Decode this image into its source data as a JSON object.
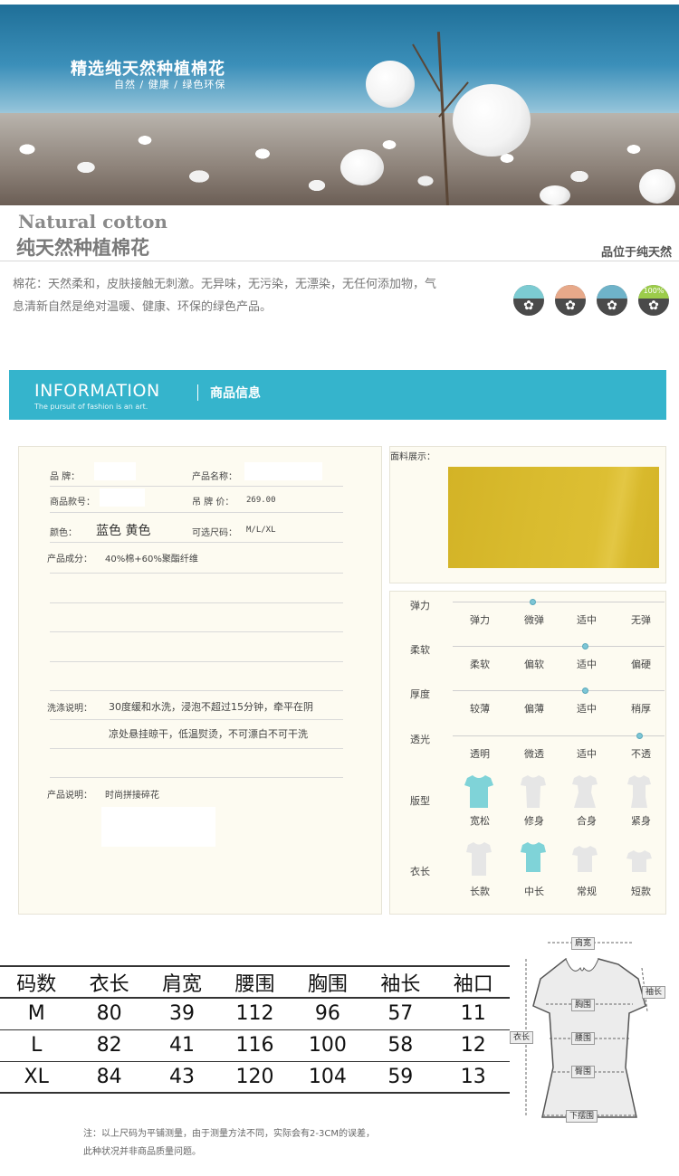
{
  "hero": {
    "title": "精选纯天然种植棉花",
    "subtitle": "自然 / 健康 / 绿色环保"
  },
  "natural": {
    "title_en": "Natural cotton",
    "title_cn": "纯天然种植棉花",
    "right_text": "品位于纯天然",
    "description": "棉花：天然柔和，皮肤接触无刺激。无异味，无污染，无漂染，无任何添加物，气息清新自然是绝对温暖、健康、环保的绿色产品。",
    "badge_text": "100%",
    "icon_colors": [
      "#7ccbd2",
      "#e7a98a",
      "#6fb3c9",
      "#9ccc4a"
    ]
  },
  "info_bar": {
    "title_en": "INFORMATION",
    "subtitle_en": "The pursuit of fashion is an art.",
    "title_cn": "商品信息"
  },
  "product": {
    "brand_label": "品 牌：",
    "name_label": "产品名称：",
    "sku_label": "商品款号：",
    "price_label": "吊 牌 价：",
    "price_value": "269.00",
    "color_label": "颜色：",
    "color_value": "蓝色  黄色",
    "sizes_label": "可选尺码：",
    "sizes_value": "M/L/XL",
    "composition_label": "产品成分：",
    "composition_value": "40%棉+60%聚酯纤维",
    "wash_label": "洗涤说明：",
    "wash_line1": "30度缓和水洗，浸泡不超过15分钟，牵平在阴",
    "wash_line2": "凉处悬挂晾干，低温熨烫，不可漂白不可干洗",
    "desc_label": "产品说明：",
    "desc_value": "时尚拼接碎花"
  },
  "fabric": {
    "label": "面料展示：",
    "color": "#d8b92c"
  },
  "attributes": [
    {
      "label": "弹力",
      "options": [
        "弹力",
        "微弹",
        "适中",
        "无弹"
      ],
      "selected": 1
    },
    {
      "label": "柔软",
      "options": [
        "柔软",
        "偏软",
        "适中",
        "偏硬"
      ],
      "selected": 2
    },
    {
      "label": "厚度",
      "options": [
        "较薄",
        "偏薄",
        "适中",
        "稍厚"
      ],
      "selected": 2
    },
    {
      "label": "透光",
      "options": [
        "透明",
        "微透",
        "适中",
        "不透"
      ],
      "selected": 3
    }
  ],
  "fit": {
    "label": "版型",
    "options": [
      "宽松",
      "修身",
      "合身",
      "紧身"
    ],
    "selected": 0
  },
  "length": {
    "label": "衣长",
    "options": [
      "长款",
      "中长",
      "常规",
      "短款"
    ],
    "selected": 1
  },
  "size_table": {
    "headers": [
      "码数",
      "衣长",
      "肩宽",
      "腰围",
      "胸围",
      "袖长",
      "袖口"
    ],
    "rows": [
      [
        "M",
        "80",
        "39",
        "112",
        "96",
        "57",
        "11"
      ],
      [
        "L",
        "82",
        "41",
        "116",
        "100",
        "58",
        "12"
      ],
      [
        "XL",
        "84",
        "43",
        "120",
        "104",
        "59",
        "13"
      ]
    ]
  },
  "diagram": {
    "shoulder": "肩宽",
    "sleeve": "袖长",
    "chest": "胸围",
    "length": "衣长",
    "waist": "腰围",
    "hip": "臀围",
    "hem": "下摆围"
  },
  "note": {
    "line1": "注：以上尺码为平铺测量，由于测量方法不同，实际会有2-3CM的误差，",
    "line2": "此种状况并非商品质量问题。"
  }
}
